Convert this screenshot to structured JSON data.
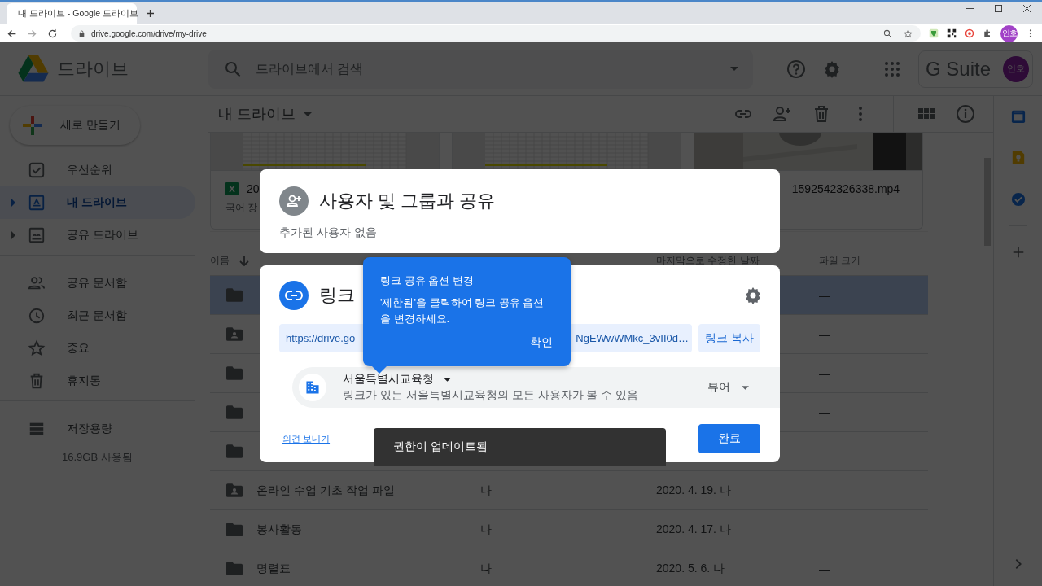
{
  "browser": {
    "tab_title": "내 드라이브 - Google 드라이브",
    "url": "drive.google.com/drive/my-drive",
    "profile": "인호"
  },
  "app": {
    "name": "드라이브",
    "search_placeholder": "드라이브에서 검색",
    "suite": "G Suite",
    "account": "인호"
  },
  "sidebar": {
    "new_button": "새로 만들기",
    "sections": [
      {
        "items": [
          {
            "label": "우선순위",
            "selected": false,
            "expandable": false
          },
          {
            "label": "내 드라이브",
            "selected": true,
            "expandable": true
          },
          {
            "label": "공유 드라이브",
            "selected": false,
            "expandable": true
          }
        ]
      },
      {
        "items": [
          {
            "label": "공유 문서함",
            "selected": false,
            "expandable": false
          },
          {
            "label": "최근 문서함",
            "selected": false,
            "expandable": false
          },
          {
            "label": "중요",
            "selected": false,
            "expandable": false
          },
          {
            "label": "휴지통",
            "selected": false,
            "expandable": false
          }
        ]
      }
    ],
    "storage": {
      "label": "저장용량",
      "usage": "16.9GB 사용됨"
    }
  },
  "main": {
    "title": "내 드라이브",
    "cards": [
      {
        "kind": "sheet",
        "title": "20",
        "subtitle": "국어 장"
      },
      {
        "kind": "sheet"
      },
      {
        "kind": "video",
        "title": "_1592542326338.mp4"
      }
    ],
    "columns": {
      "name": "이름",
      "modified": "마지막으로 수정한 날짜",
      "size": "파일 크기"
    },
    "rows": [
      {
        "kind": "folder",
        "selected": true,
        "size": "—"
      },
      {
        "kind": "shared_folder",
        "selected": false,
        "size": "—"
      },
      {
        "kind": "folder",
        "selected": false,
        "size": "—"
      },
      {
        "kind": "folder",
        "selected": false,
        "size": "—"
      },
      {
        "kind": "folder",
        "selected": false,
        "size": "—"
      },
      {
        "kind": "shared_folder",
        "selected": false,
        "name": "온라인 수업 기초 작업 파일",
        "owner": "나",
        "modified": "2020. 4. 19. 나",
        "size": "—"
      },
      {
        "kind": "folder",
        "selected": false,
        "name": "봉사활동",
        "owner": "나",
        "modified": "2020. 4. 17. 나",
        "size": "—"
      },
      {
        "kind": "folder",
        "selected": false,
        "name": "명렬표",
        "owner": "나",
        "modified": "2020. 5. 6. 나",
        "size": "—"
      }
    ]
  },
  "share_dialog": {
    "people_title": "사용자 및 그룹과 공유",
    "people_note": "추가된 사용자 없음",
    "link_title": "링크",
    "url_start": "https://drive.go",
    "url_end": "NgEWwWMkc_3vII0d…",
    "copy_button": "링크 복사",
    "audience": "서울특별시교육청",
    "audience_note": "링크가 있는 서울특별시교육청의 모든 사용자가 볼 수 있음",
    "role": "뷰어",
    "feedback": "의견 보내기",
    "done_button": "완료"
  },
  "tooltip": {
    "title": "링크 공유 옵션 변경",
    "body": "'제한됨'을 클릭하여 링크 공유 옵션을 변경하세요.",
    "button": "확인"
  },
  "snackbar": "권한이 업데이트됨"
}
